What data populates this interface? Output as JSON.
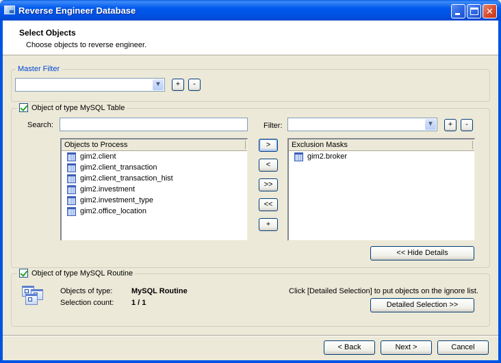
{
  "window": {
    "title": "Reverse Engineer Database",
    "icon": "database-app-icon",
    "controls": [
      "minimize",
      "maximize",
      "close"
    ]
  },
  "header": {
    "title": "Select Objects",
    "subtitle": "Choose objects to reverse engineer."
  },
  "master_filter": {
    "legend": "Master Filter",
    "value": "",
    "add_label": "+",
    "remove_label": "-"
  },
  "table_section": {
    "checkbox_label": "Object of type MySQL Table",
    "checked": true,
    "search_label": "Search:",
    "search_value": "",
    "filter_label": "Filter:",
    "filter_value": "",
    "filter_add_label": "+",
    "filter_remove_label": "-",
    "objects_header": "Objects to Process",
    "objects": [
      {
        "name": "gim2.client",
        "icon": "table-icon"
      },
      {
        "name": "gim2.client_transaction",
        "icon": "table-icon"
      },
      {
        "name": "gim2.client_transaction_hist",
        "icon": "table-icon"
      },
      {
        "name": "gim2.investment",
        "icon": "table-icon"
      },
      {
        "name": "gim2.investment_type",
        "icon": "table-icon"
      },
      {
        "name": "gim2.office_location",
        "icon": "table-icon"
      }
    ],
    "exclusion_header": "Exclusion Masks",
    "exclusions": [
      {
        "name": "gim2.broker",
        "icon": "table-icon"
      }
    ],
    "move_buttons": {
      "move_right": ">",
      "move_left": "<",
      "move_all_right": ">>",
      "move_all_left": "<<",
      "add": "+"
    },
    "hide_details_label": "<< Hide Details"
  },
  "routine_section": {
    "checkbox_label": "Object of type MySQL Routine",
    "checked": true,
    "objects_of_type_label": "Objects of type:",
    "objects_of_type_value": "MySQL Routine",
    "selection_count_label": "Selection count:",
    "selection_count_value": "1 / 1",
    "hint": "Click [Detailed Selection] to put objects on the ignore list.",
    "detailed_selection_label": "Detailed Selection >>"
  },
  "footer": {
    "back_label": "< Back",
    "next_label": "Next >",
    "cancel_label": "Cancel"
  }
}
